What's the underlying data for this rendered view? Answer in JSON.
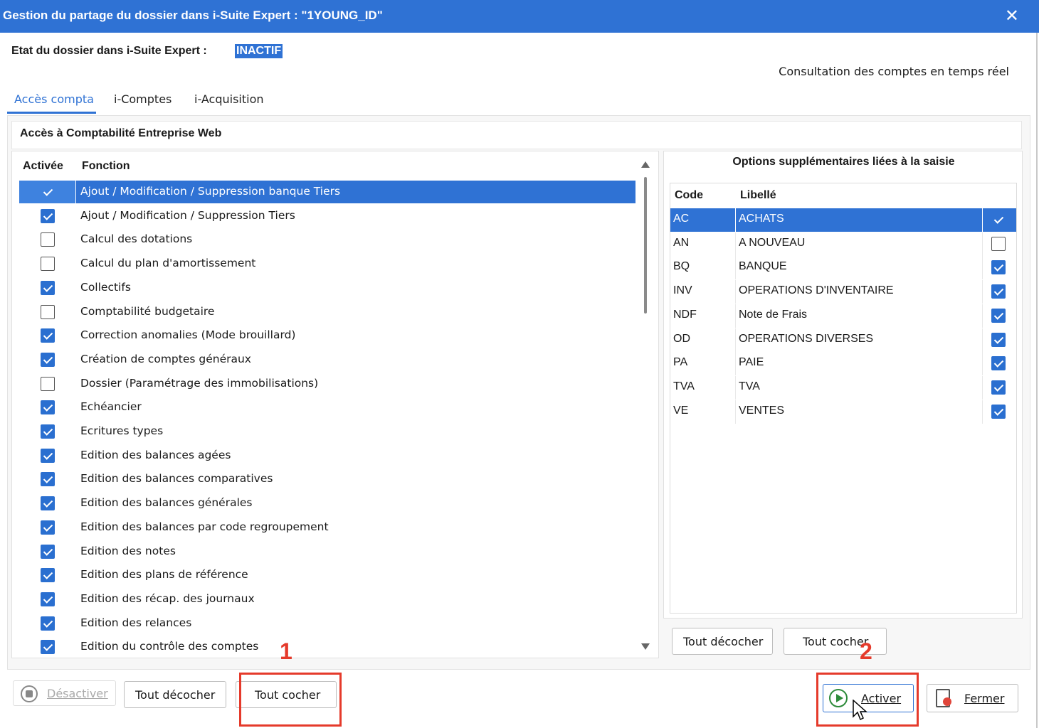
{
  "window": {
    "title": "Gestion du partage du dossier dans i-Suite Expert : \"1YOUNG_ID\"",
    "close_glyph": "✕"
  },
  "status": {
    "label": "Etat du dossier dans i-Suite Expert :",
    "value": "INACTIF",
    "consult_text": "Consultation des comptes en temps réel"
  },
  "tabs": [
    {
      "label": "Accès compta",
      "active": true
    },
    {
      "label": "i-Comptes",
      "active": false
    },
    {
      "label": "i-Acquisition",
      "active": false
    }
  ],
  "section_title": "Accès à Comptabilité Entreprise Web",
  "functions": {
    "headers": {
      "active": "Activée",
      "function": "Fonction"
    },
    "rows": [
      {
        "label": "Ajout / Modification / Suppression banque Tiers",
        "checked": true,
        "selected": true
      },
      {
        "label": "Ajout / Modification / Suppression Tiers",
        "checked": true
      },
      {
        "label": "Calcul des dotations",
        "checked": false
      },
      {
        "label": "Calcul du plan d'amortissement",
        "checked": false
      },
      {
        "label": "Collectifs",
        "checked": true
      },
      {
        "label": "Comptabilité budgetaire",
        "checked": false
      },
      {
        "label": "Correction anomalies (Mode brouillard)",
        "checked": true
      },
      {
        "label": "Création de comptes généraux",
        "checked": true
      },
      {
        "label": "Dossier (Paramétrage des immobilisations)",
        "checked": false
      },
      {
        "label": "Echéancier",
        "checked": true
      },
      {
        "label": "Ecritures types",
        "checked": true
      },
      {
        "label": "Edition des balances agées",
        "checked": true
      },
      {
        "label": "Edition des balances comparatives",
        "checked": true
      },
      {
        "label": "Edition des balances générales",
        "checked": true
      },
      {
        "label": "Edition des balances par code regroupement",
        "checked": true
      },
      {
        "label": "Edition des notes",
        "checked": true
      },
      {
        "label": "Edition des plans de référence",
        "checked": true
      },
      {
        "label": "Edition des récap. des journaux",
        "checked": true
      },
      {
        "label": "Edition des relances",
        "checked": true
      },
      {
        "label": "Edition du contrôle des comptes",
        "checked": true
      }
    ]
  },
  "options": {
    "title": "Options supplémentaires liées à la saisie",
    "headers": {
      "code": "Code",
      "libelle": "Libellé"
    },
    "rows": [
      {
        "code": "AC",
        "libelle": "ACHATS",
        "checked": true,
        "selected": true
      },
      {
        "code": "AN",
        "libelle": "A NOUVEAU",
        "checked": false
      },
      {
        "code": "BQ",
        "libelle": "BANQUE",
        "checked": true
      },
      {
        "code": "INV",
        "libelle": "OPERATIONS D'INVENTAIRE",
        "checked": true
      },
      {
        "code": "NDF",
        "libelle": "Note de Frais",
        "checked": true
      },
      {
        "code": "OD",
        "libelle": "OPERATIONS DIVERSES",
        "checked": true
      },
      {
        "code": "PA",
        "libelle": "PAIE",
        "checked": true
      },
      {
        "code": "TVA",
        "libelle": "TVA",
        "checked": true
      },
      {
        "code": "VE",
        "libelle": "VENTES",
        "checked": true
      }
    ],
    "uncheck_all": "Tout décocher",
    "check_all": "Tout cocher"
  },
  "footer": {
    "deactivate": "Désactiver",
    "uncheck_all": "Tout décocher",
    "check_all": "Tout cocher",
    "activate": "Activer",
    "close": "Fermer"
  },
  "annotations": {
    "step1": "1",
    "step2": "2",
    "color": "#e53a2b"
  },
  "colors": {
    "accent": "#2f72d4",
    "checkbox": "#2a6fd0"
  }
}
